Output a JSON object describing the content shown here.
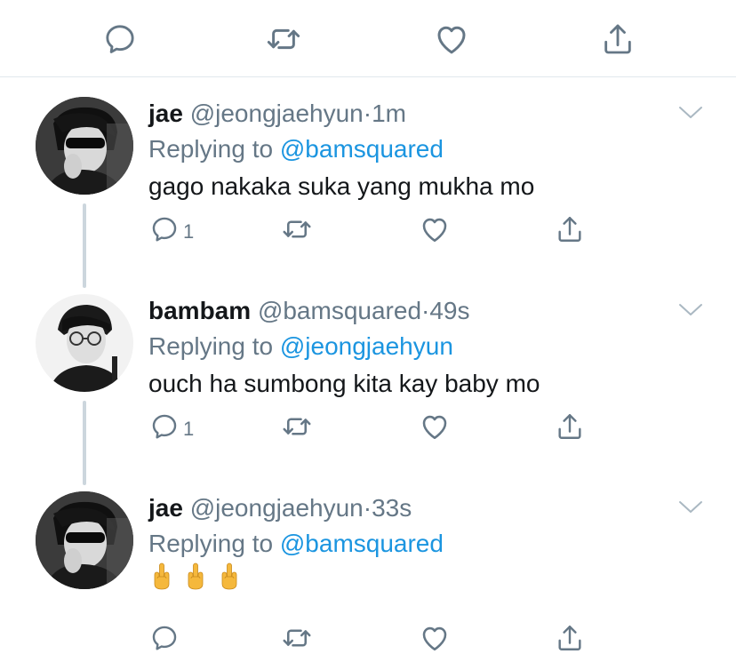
{
  "top_actions": {
    "reply_icon": "reply-icon",
    "retweet_icon": "retweet-icon",
    "like_icon": "heart-icon",
    "share_icon": "share-icon"
  },
  "colors": {
    "icon_gray": "#657786",
    "link_blue": "#1b95e0",
    "divider": "#e1e8ed",
    "thread_line": "#ccd6dd"
  },
  "tweets": [
    {
      "display_name": "jae",
      "handle": "@jeongjaehyun",
      "dot": "·",
      "time": "1m",
      "replying_prefix": "Replying to",
      "replying_to": "@bamsquared",
      "text": "gago nakaka suka yang mukha mo",
      "reply_count": "1"
    },
    {
      "display_name": "bambam",
      "handle": "@bamsquared",
      "dot": "·",
      "time": "49s",
      "replying_prefix": "Replying to",
      "replying_to": "@jeongjaehyun",
      "text": "ouch ha sumbong kita kay baby mo",
      "reply_count": "1"
    },
    {
      "display_name": "jae",
      "handle": "@jeongjaehyun",
      "dot": "·",
      "time": "33s",
      "replying_prefix": "Replying to",
      "replying_to": "@bamsquared",
      "emojis": [
        "middle-finger-emoji",
        "middle-finger-emoji",
        "middle-finger-emoji"
      ],
      "reply_count": ""
    }
  ]
}
